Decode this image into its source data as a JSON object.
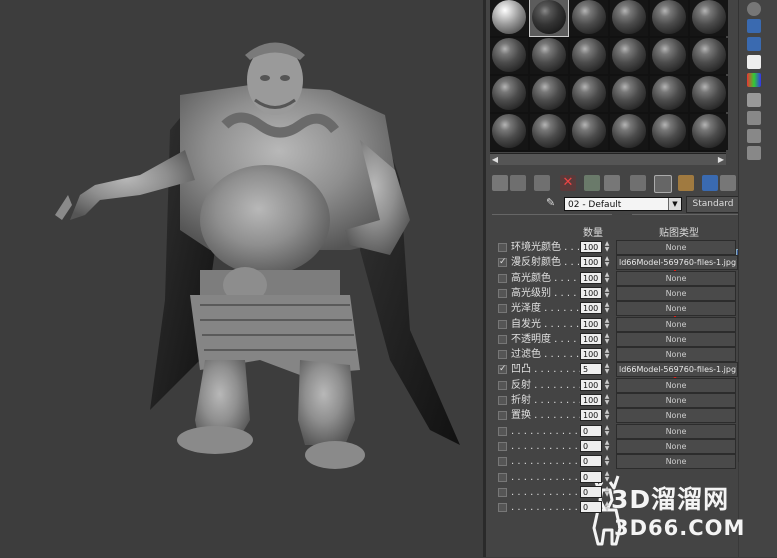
{
  "material_editor": {
    "material_name": "02 - Default",
    "material_type": "Standard"
  },
  "maps_rollout": {
    "col_amount": "数量",
    "col_map_type": "贴图类型",
    "rows": [
      {
        "checked": false,
        "label": "环境光颜色 . . .",
        "amount": "100",
        "map": "None"
      },
      {
        "checked": true,
        "label": "漫反射颜色 . . .",
        "amount": "100",
        "map": "ld66Model-569760-files-1.jpg)"
      },
      {
        "checked": false,
        "label": "高光颜色 . . . . .",
        "amount": "100",
        "map": "None"
      },
      {
        "checked": false,
        "label": "高光级别 . . . . .",
        "amount": "100",
        "map": "None"
      },
      {
        "checked": false,
        "label": "光泽度 . . . . . .",
        "amount": "100",
        "map": "None"
      },
      {
        "checked": false,
        "label": "自发光 . . . . . .",
        "amount": "100",
        "map": "None"
      },
      {
        "checked": false,
        "label": "不透明度 . . . . .",
        "amount": "100",
        "map": "None"
      },
      {
        "checked": false,
        "label": "过滤色 . . . . . .",
        "amount": "100",
        "map": "None"
      },
      {
        "checked": true,
        "label": "凹凸 . . . . . . . .",
        "amount": "5",
        "map": "ld66Model-569760-files-1.jpg)"
      },
      {
        "checked": false,
        "label": "反射 . . . . . . . .",
        "amount": "100",
        "map": "None"
      },
      {
        "checked": false,
        "label": "折射 . . . . . . . .",
        "amount": "100",
        "map": "None"
      },
      {
        "checked": false,
        "label": "置换 . . . . . . . .",
        "amount": "100",
        "map": "None"
      },
      {
        "checked": false,
        "label": ". . . . . . . . . . .",
        "amount": "0",
        "map": "None"
      },
      {
        "checked": false,
        "label": ". . . . . . . . . . .",
        "amount": "0",
        "map": "None"
      },
      {
        "checked": false,
        "label": ". . . . . . . . . . .",
        "amount": "0",
        "map": "None"
      },
      {
        "checked": false,
        "label": ". . . . . . . . . . .",
        "amount": "0",
        "map": ""
      },
      {
        "checked": false,
        "label": ". . . . . . . . . . .",
        "amount": "0",
        "map": ""
      },
      {
        "checked": false,
        "label": ". . . . . . . . . . .",
        "amount": "0",
        "map": ""
      }
    ]
  },
  "watermark": {
    "title": "3D溜溜网",
    "url": "3D66.COM"
  },
  "colors": {
    "viewport_bg": "#3d3d3d",
    "panel_bg": "#444444",
    "annotation_arrow": "#e0201a"
  }
}
